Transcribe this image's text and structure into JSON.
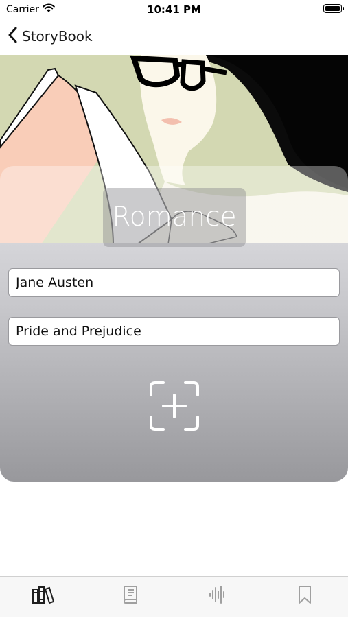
{
  "status_bar": {
    "carrier": "Carrier",
    "time": "10:41 PM"
  },
  "nav": {
    "back_label": "StoryBook"
  },
  "genre": {
    "title": "Romance"
  },
  "form": {
    "author_value": "Jane Austen",
    "title_value": "Pride and Prejudice"
  },
  "icons": {
    "add_photo": "add-photo-icon",
    "tabs": [
      "library-icon",
      "book-icon",
      "waveform-icon",
      "bookmark-icon"
    ]
  },
  "colors": {
    "tab_selected": "#1f1f1f",
    "tab_unselected": "#a0a0a0"
  }
}
